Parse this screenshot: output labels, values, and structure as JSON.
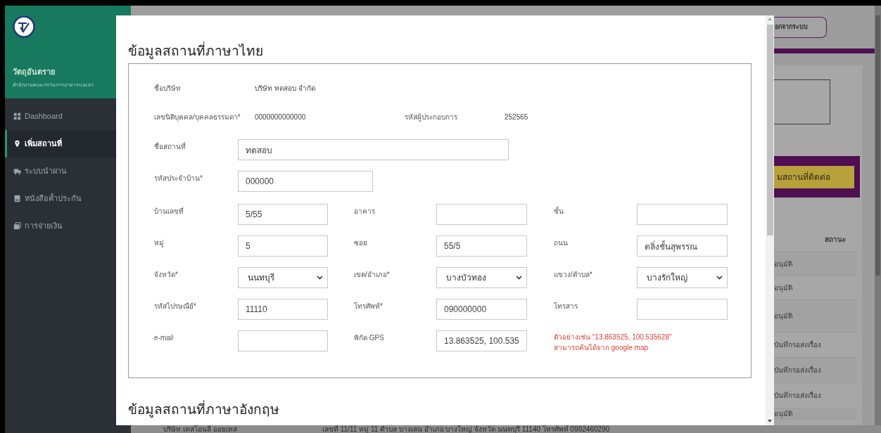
{
  "sidebar": {
    "brand_title": "วัตถุอันตราย",
    "brand_subtitle": "สำนักงานคณะกรรมการอาหารและยา",
    "items": [
      {
        "label": "Dashboard",
        "selected": false
      },
      {
        "label": "เพิ่มสถานที่",
        "selected": true
      },
      {
        "label": "ระบบนำผ่าน",
        "selected": false
      },
      {
        "label": "หนังสือค้ำประกัน",
        "selected": false
      },
      {
        "label": "การจ่ายเงิน",
        "selected": false
      }
    ]
  },
  "background": {
    "logout_button": "อกจากระบบ",
    "add_contact_button": "มสถานที่ติดต่อ",
    "table": {
      "columns": [
        "สถานะ"
      ],
      "rows": [
        [
          "อนุมัติ"
        ],
        [
          "อนุมัติ"
        ],
        [
          "อนุมัติ"
        ],
        [
          "บันทึกรอส่งเรื่อง"
        ],
        [
          "บันทึกรอส่งเรื่อง"
        ],
        [
          "บันทึกรอส่งเรื่อง"
        ],
        [
          "อนุมัติ"
        ]
      ]
    },
    "bottom_row": {
      "company": "บริษัท เทสโอนลี ออยเทส",
      "address": "เลขที่ 11/11 หมู่ 11 ตำบล บางเลน อำเภอ บางใหญ่ จังหวัด นนทบุรี 11140 โทรศัพท์ 0992460290"
    }
  },
  "modal": {
    "title": "ข้อมูลสถานที่ภาษาไทย",
    "info": [
      {
        "label": "ชื่อบริษัท",
        "value": "บริษัท ทดสอบ จำกัด"
      },
      {
        "label": "เลขนิติบุคคล/บุคคลธรรมดา*",
        "value": "0000000000000"
      },
      {
        "label": "รหัสผู้ประกอบการ",
        "value": "252565"
      }
    ],
    "wide_fields": [
      {
        "label": "ชื่อสถานที่",
        "value": "ทดสอบ",
        "kind": "wide"
      },
      {
        "label": "รหัสประจำบ้าน*",
        "value": "000000",
        "kind": "medium"
      }
    ],
    "grid": [
      {
        "kind": "input",
        "label": "บ้านเลขที่",
        "value": "5/55"
      },
      {
        "kind": "input",
        "label": "อาคาร"
      },
      {
        "kind": "input",
        "label": "ชั้น"
      },
      {
        "kind": "input",
        "label": "หมู่",
        "value": "5"
      },
      {
        "kind": "input",
        "label": "ซอย",
        "value": "55/5"
      },
      {
        "kind": "input",
        "label": "ถนน",
        "value": "ตลิ่งชั้นสุพรรณ"
      },
      {
        "kind": "select",
        "label": "จังหวัด*",
        "value": "นนทบุรี"
      },
      {
        "kind": "select",
        "label": "เขต/อำเภอ*",
        "value": "บางบัวทอง"
      },
      {
        "kind": "select",
        "label": "แขวง/ตำบล*",
        "value": "บางรักใหญ่"
      },
      {
        "kind": "input",
        "label": "รหัสไปรษณีย์*",
        "value": "11110"
      },
      {
        "kind": "input",
        "label": "โทรศัพท์*",
        "value": "090000000"
      },
      {
        "kind": "input",
        "label": "โทรสาร"
      },
      {
        "kind": "input",
        "label": "e-mail"
      },
      {
        "kind": "input",
        "label": "พิกัด GPS",
        "value": "13.863525, 100.535"
      },
      {
        "kind": "hint",
        "lines": [
          "ตัวอย่างเช่น \"13.863525, 100.535628\"",
          "สามารถค้นได้จาก google map"
        ]
      }
    ],
    "section2_title": "ข้อมูลสถานที่ภาษาอังกฤษ"
  }
}
